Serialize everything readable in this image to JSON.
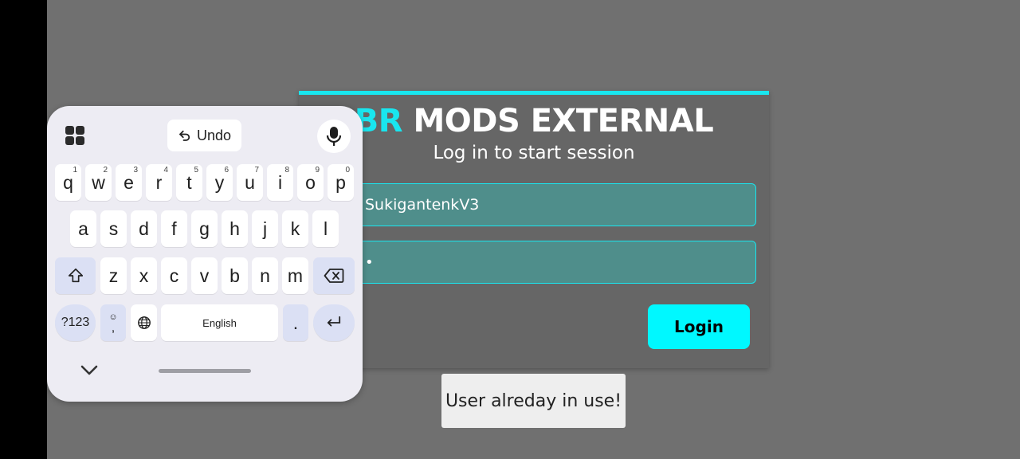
{
  "login": {
    "title_accent": "BR",
    "title_rest": "MODS EXTERNAL",
    "subtitle": "Log in to start session",
    "username_value": "SukigantenkV3",
    "password_value": "•",
    "login_label": "Login"
  },
  "toast": {
    "message": "User alreday in use!"
  },
  "keyboard": {
    "undo_label": "Undo",
    "row1": [
      {
        "k": "q",
        "h": "1"
      },
      {
        "k": "w",
        "h": "2"
      },
      {
        "k": "e",
        "h": "3"
      },
      {
        "k": "r",
        "h": "4"
      },
      {
        "k": "t",
        "h": "5"
      },
      {
        "k": "y",
        "h": "6"
      },
      {
        "k": "u",
        "h": "7"
      },
      {
        "k": "i",
        "h": "8"
      },
      {
        "k": "o",
        "h": "9"
      },
      {
        "k": "p",
        "h": "0"
      }
    ],
    "row2": [
      "a",
      "s",
      "d",
      "f",
      "g",
      "h",
      "j",
      "k",
      "l"
    ],
    "row3": [
      "z",
      "x",
      "c",
      "v",
      "b",
      "n",
      "m"
    ],
    "symbols_label": "?123",
    "comma_label": ",",
    "emoji_hint": "☺",
    "space_label": "English",
    "period_label": "."
  },
  "colors": {
    "accent": "#19e6ef",
    "button": "#00f8ff",
    "field_bg": "#4f8e8b",
    "panel_bg": "#666666"
  }
}
